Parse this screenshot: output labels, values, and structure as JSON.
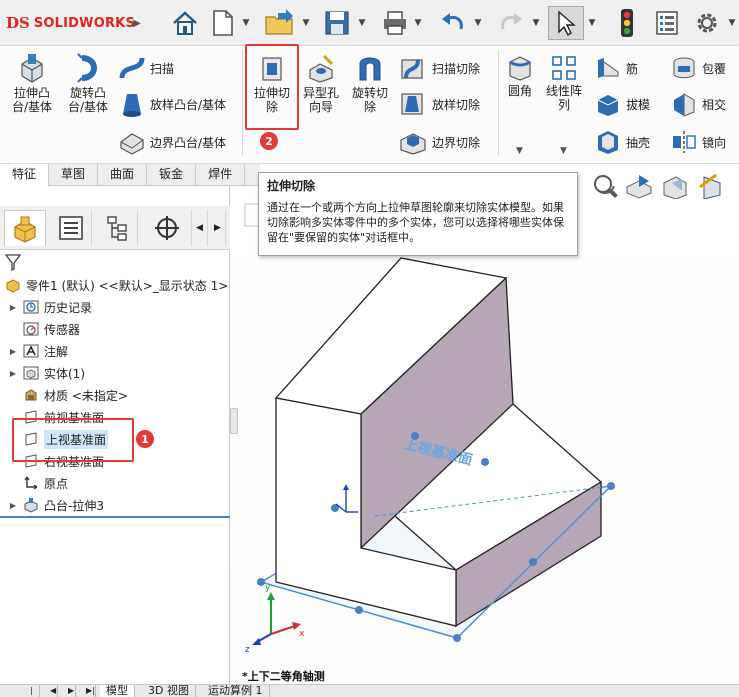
{
  "app": {
    "logo_prefix": "DS",
    "logo_name": "SOLIDWORKS"
  },
  "ribbon": {
    "extrude_boss": "拉伸凸\n台/基体",
    "revolve_boss": "旋转凸\n台/基体",
    "sweep": "扫描",
    "loft_boss": "放样凸台/基体",
    "boundary_boss": "边界凸台/基体",
    "extrude_cut": "拉伸切\n除",
    "hole_wizard": "异型孔\n向导",
    "revolve_cut": "旋转切\n除",
    "swept_cut": "扫描切除",
    "lofted_cut": "放样切除",
    "boundary_cut": "边界切除",
    "fillet": "圆角",
    "linear_pattern": "线性阵\n列",
    "rib": "筋",
    "draft": "拔模",
    "shell": "抽壳",
    "wrap": "包覆",
    "intersect": "相交",
    "mirror": "镜向"
  },
  "tabs": [
    "特征",
    "草图",
    "曲面",
    "钣金",
    "焊件"
  ],
  "tooltip": {
    "title": "拉伸切除",
    "body": "通过在一个或两个方向上拉伸草图轮廓来切除实体模型。如果切除影响多实体零件中的多个实体，您可以选择将哪些实体保留在\"要保留的实体\"对话框中。"
  },
  "badges": {
    "one": "1",
    "two": "2"
  },
  "tree": {
    "root": "零件1 (默认) <<默认>_显示状态 1>",
    "items": [
      "历史记录",
      "传感器",
      "注解",
      "实体(1)",
      "材质 <未指定>",
      "前视基准面",
      "上视基准面",
      "右视基准面",
      "原点",
      "凸台-拉伸3"
    ]
  },
  "viewport": {
    "plane_label": "上视基准面",
    "view_name": "*上下二等角轴测",
    "axis_x": "x",
    "axis_y": "y",
    "axis_z": "z"
  },
  "bottom_tabs": [
    "模型",
    "3D 视图",
    "运动算例 1"
  ],
  "colors": {
    "brand_red": "#e2231a",
    "highlight_red": "#e53935",
    "selection_blue": "#cfe6fb",
    "face_purple": "#b7a6b6",
    "plane_blue": "#4a90d9"
  }
}
